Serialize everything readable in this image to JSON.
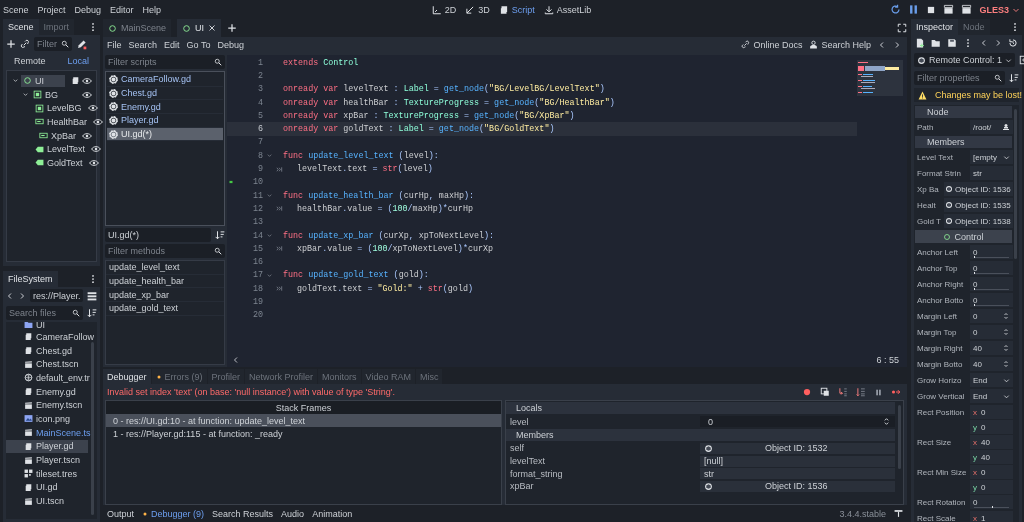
{
  "menu": [
    "Scene",
    "Project",
    "Debug",
    "Editor",
    "Help"
  ],
  "workspaces": [
    {
      "label": "2D",
      "selected": false
    },
    {
      "label": "3D",
      "selected": false
    },
    {
      "label": "Script",
      "selected": true
    },
    {
      "label": "AssetLib",
      "selected": false
    }
  ],
  "renderer": "GLES3",
  "scene_dock": {
    "tabs": [
      {
        "label": "Scene",
        "selected": true
      },
      {
        "label": "Import",
        "selected": false
      }
    ],
    "filter": {
      "placeholder": "Filter"
    },
    "modes": [
      {
        "label": "Remote",
        "selected": false
      },
      {
        "label": "Local",
        "selected": true
      }
    ],
    "tree": [
      {
        "name": "UI",
        "kind": "control",
        "selected": true,
        "script": true,
        "expanded": true,
        "children": [
          {
            "name": "BG",
            "kind": "panel",
            "selected": false,
            "expanded": true,
            "children": [
              {
                "name": "LevelBG",
                "kind": "panel",
                "selected": false
              },
              {
                "name": "HealthBar",
                "kind": "progress",
                "selected": false
              },
              {
                "name": "XpBar",
                "kind": "progress",
                "selected": false
              },
              {
                "name": "LevelText",
                "kind": "label",
                "selected": false
              },
              {
                "name": "GoldText",
                "kind": "label",
                "selected": false
              }
            ]
          }
        ]
      }
    ]
  },
  "filesystem": {
    "tab": "FileSystem",
    "path": "res://Player.",
    "search": {
      "placeholder": "Search files"
    },
    "files": [
      {
        "name": "UI",
        "kind": "folder",
        "selected": false,
        "highlighted": false
      },
      {
        "name": "CameraFollow",
        "kind": "script",
        "selected": false,
        "highlighted": false
      },
      {
        "name": "Chest.gd",
        "kind": "script",
        "selected": false,
        "highlighted": false
      },
      {
        "name": "Chest.tscn",
        "kind": "scene",
        "selected": false,
        "highlighted": false
      },
      {
        "name": "default_env.tr",
        "kind": "environment",
        "selected": false,
        "highlighted": false
      },
      {
        "name": "Enemy.gd",
        "kind": "script",
        "selected": false,
        "highlighted": false
      },
      {
        "name": "Enemy.tscn",
        "kind": "scene",
        "selected": false,
        "highlighted": false
      },
      {
        "name": "icon.png",
        "kind": "image",
        "selected": false,
        "highlighted": false
      },
      {
        "name": "MainScene.ts",
        "kind": "scene",
        "selected": false,
        "highlighted": true
      },
      {
        "name": "Player.gd",
        "kind": "script",
        "selected": true,
        "highlighted": false
      },
      {
        "name": "Player.tscn",
        "kind": "scene",
        "selected": false,
        "highlighted": false
      },
      {
        "name": "tileset.tres",
        "kind": "tileset",
        "selected": false,
        "highlighted": false
      },
      {
        "name": "UI.gd",
        "kind": "script",
        "selected": false,
        "highlighted": false
      },
      {
        "name": "UI.tscn",
        "kind": "scene",
        "selected": false,
        "highlighted": false
      }
    ]
  },
  "scene_tabs": [
    {
      "label": "MainScene",
      "selected": false
    },
    {
      "label": "UI",
      "selected": true
    }
  ],
  "script_menu": [
    "File",
    "Search",
    "Edit",
    "Go To",
    "Debug"
  ],
  "help_links": [
    "Online Docs",
    "Search Help"
  ],
  "scripts": {
    "filter": {
      "placeholder": "Filter scripts"
    },
    "items": [
      {
        "name": "CameraFollow.gd",
        "selected": false
      },
      {
        "name": "Chest.gd",
        "selected": false
      },
      {
        "name": "Enemy.gd",
        "selected": false
      },
      {
        "name": "Player.gd",
        "selected": false
      },
      {
        "name": "UI.gd(*)",
        "selected": true
      }
    ]
  },
  "methods": {
    "title": "UI.gd(*)",
    "filter": {
      "placeholder": "Filter methods"
    },
    "items": [
      "update_level_text",
      "update_health_bar",
      "update_xp_bar",
      "update_gold_text"
    ]
  },
  "code": {
    "cursor": "6 : 55",
    "lines": [
      {
        "number": "1",
        "fold": false,
        "indent": false,
        "current": false,
        "executing": false,
        "tokens": [
          {
            "kind": "kw",
            "text": "extends "
          },
          {
            "kind": "type",
            "text": "Control"
          }
        ]
      },
      {
        "number": "2",
        "fold": false,
        "indent": false,
        "current": false,
        "executing": false
      },
      {
        "number": "3",
        "fold": false,
        "indent": false,
        "current": false,
        "executing": false,
        "tokens": [
          {
            "kind": "kw",
            "text": "onready var "
          },
          {
            "kind": "id",
            "text": "levelText "
          },
          {
            "kind": "sym",
            "text": ": "
          },
          {
            "kind": "type",
            "text": "Label"
          },
          {
            "kind": "sym",
            "text": " = "
          },
          {
            "kind": "fn",
            "text": "get_node"
          },
          {
            "kind": "sym",
            "text": "("
          },
          {
            "kind": "str",
            "text": "\"BG/LevelBG/LevelText\""
          },
          {
            "kind": "sym",
            "text": ")"
          }
        ]
      },
      {
        "number": "4",
        "fold": false,
        "indent": false,
        "current": false,
        "executing": false,
        "tokens": [
          {
            "kind": "kw",
            "text": "onready var "
          },
          {
            "kind": "id",
            "text": "healthBar "
          },
          {
            "kind": "sym",
            "text": ": "
          },
          {
            "kind": "type",
            "text": "TextureProgress"
          },
          {
            "kind": "sym",
            "text": " = "
          },
          {
            "kind": "fn",
            "text": "get_node"
          },
          {
            "kind": "sym",
            "text": "("
          },
          {
            "kind": "str",
            "text": "\"BG/HealthBar\""
          },
          {
            "kind": "sym",
            "text": ")"
          }
        ]
      },
      {
        "number": "5",
        "fold": false,
        "indent": false,
        "current": false,
        "executing": false,
        "tokens": [
          {
            "kind": "kw",
            "text": "onready var "
          },
          {
            "kind": "id",
            "text": "xpBar "
          },
          {
            "kind": "sym",
            "text": ": "
          },
          {
            "kind": "type",
            "text": "TextureProgress"
          },
          {
            "kind": "sym",
            "text": " = "
          },
          {
            "kind": "fn",
            "text": "get_node"
          },
          {
            "kind": "sym",
            "text": "("
          },
          {
            "kind": "str",
            "text": "\"BG/XpBar\""
          },
          {
            "kind": "sym",
            "text": ")"
          }
        ]
      },
      {
        "number": "6",
        "fold": false,
        "indent": false,
        "current": true,
        "executing": false,
        "tokens": [
          {
            "kind": "kw",
            "text": "onready var "
          },
          {
            "kind": "id",
            "text": "goldText "
          },
          {
            "kind": "sym",
            "text": ": "
          },
          {
            "kind": "type",
            "text": "Label"
          },
          {
            "kind": "sym",
            "text": " = "
          },
          {
            "kind": "fn",
            "text": "get_node"
          },
          {
            "kind": "sym",
            "text": "("
          },
          {
            "kind": "str",
            "text": "\"BG/GoldText\""
          },
          {
            "kind": "sym",
            "text": ")"
          }
        ]
      },
      {
        "number": "7",
        "fold": false,
        "indent": false,
        "current": false,
        "executing": false
      },
      {
        "number": "8",
        "fold": true,
        "indent": false,
        "current": false,
        "executing": false,
        "tokens": [
          {
            "kind": "kw",
            "text": "func "
          },
          {
            "kind": "fn",
            "text": "update_level_text"
          },
          {
            "kind": "sym",
            "text": " ("
          },
          {
            "kind": "id",
            "text": "level"
          },
          {
            "kind": "sym",
            "text": "):"
          }
        ]
      },
      {
        "number": "9",
        "fold": false,
        "indent": true,
        "current": false,
        "executing": false,
        "tokens": [
          {
            "kind": "id",
            "text": "levelText"
          },
          {
            "kind": "sym",
            "text": "."
          },
          {
            "kind": "id",
            "text": "text "
          },
          {
            "kind": "sym",
            "text": "= "
          },
          {
            "kind": "kw",
            "text": "str"
          },
          {
            "kind": "sym",
            "text": "("
          },
          {
            "kind": "id",
            "text": "level"
          },
          {
            "kind": "sym",
            "text": ")"
          }
        ]
      },
      {
        "number": "10",
        "fold": false,
        "indent": false,
        "current": false,
        "executing": true
      },
      {
        "number": "11",
        "fold": true,
        "indent": false,
        "current": false,
        "executing": false,
        "tokens": [
          {
            "kind": "kw",
            "text": "func "
          },
          {
            "kind": "fn",
            "text": "update_health_bar"
          },
          {
            "kind": "sym",
            "text": " ("
          },
          {
            "kind": "id",
            "text": "curHp"
          },
          {
            "kind": "sym",
            "text": ", "
          },
          {
            "kind": "id",
            "text": "maxHp"
          },
          {
            "kind": "sym",
            "text": "):"
          }
        ]
      },
      {
        "number": "12",
        "fold": false,
        "indent": true,
        "current": false,
        "executing": false,
        "tokens": [
          {
            "kind": "id",
            "text": "healthBar"
          },
          {
            "kind": "sym",
            "text": "."
          },
          {
            "kind": "id",
            "text": "value "
          },
          {
            "kind": "sym",
            "text": "= ("
          },
          {
            "kind": "num",
            "text": "100"
          },
          {
            "kind": "sym",
            "text": "/"
          },
          {
            "kind": "id",
            "text": "maxHp"
          },
          {
            "kind": "sym",
            "text": ")*"
          },
          {
            "kind": "id",
            "text": "curHp"
          }
        ]
      },
      {
        "number": "13",
        "fold": false,
        "indent": false,
        "current": false,
        "executing": false
      },
      {
        "number": "14",
        "fold": true,
        "indent": false,
        "current": false,
        "executing": false,
        "tokens": [
          {
            "kind": "kw",
            "text": "func "
          },
          {
            "kind": "fn",
            "text": "update_xp_bar"
          },
          {
            "kind": "sym",
            "text": " ("
          },
          {
            "kind": "id",
            "text": "curXp"
          },
          {
            "kind": "sym",
            "text": ", "
          },
          {
            "kind": "id",
            "text": "xpToNextLevel"
          },
          {
            "kind": "sym",
            "text": "):"
          }
        ]
      },
      {
        "number": "15",
        "fold": false,
        "indent": true,
        "current": false,
        "executing": false,
        "tokens": [
          {
            "kind": "id",
            "text": "xpBar"
          },
          {
            "kind": "sym",
            "text": "."
          },
          {
            "kind": "id",
            "text": "value "
          },
          {
            "kind": "sym",
            "text": "= ("
          },
          {
            "kind": "num",
            "text": "100"
          },
          {
            "kind": "sym",
            "text": "/"
          },
          {
            "kind": "id",
            "text": "xpToNextLevel"
          },
          {
            "kind": "sym",
            "text": ")*"
          },
          {
            "kind": "id",
            "text": "curXp"
          }
        ]
      },
      {
        "number": "16",
        "fold": false,
        "indent": false,
        "current": false,
        "executing": false
      },
      {
        "number": "17",
        "fold": true,
        "indent": false,
        "current": false,
        "executing": false,
        "tokens": [
          {
            "kind": "kw",
            "text": "func "
          },
          {
            "kind": "fn",
            "text": "update_gold_text"
          },
          {
            "kind": "sym",
            "text": " ("
          },
          {
            "kind": "id",
            "text": "gold"
          },
          {
            "kind": "sym",
            "text": "):"
          }
        ]
      },
      {
        "number": "18",
        "fold": false,
        "indent": true,
        "current": false,
        "executing": false,
        "tokens": [
          {
            "kind": "id",
            "text": "goldText"
          },
          {
            "kind": "sym",
            "text": "."
          },
          {
            "kind": "id",
            "text": "text "
          },
          {
            "kind": "sym",
            "text": "= "
          },
          {
            "kind": "str",
            "text": "\"Gold:\""
          },
          {
            "kind": "sym",
            "text": " + "
          },
          {
            "kind": "kw",
            "text": "str"
          },
          {
            "kind": "sym",
            "text": "("
          },
          {
            "kind": "id",
            "text": "gold"
          },
          {
            "kind": "sym",
            "text": ")"
          }
        ]
      },
      {
        "number": "19",
        "fold": false,
        "indent": false,
        "current": false,
        "executing": false
      },
      {
        "number": "20",
        "fold": false,
        "indent": false,
        "current": false,
        "executing": false
      }
    ]
  },
  "debugger": {
    "tabs": [
      {
        "label": "Debugger",
        "selected": true,
        "dot": false
      },
      {
        "label": "Errors (9)",
        "selected": false,
        "dot": true
      },
      {
        "label": "Profiler",
        "selected": false,
        "dot": false
      },
      {
        "label": "Network Profiler",
        "selected": false,
        "dot": false
      },
      {
        "label": "Monitors",
        "selected": false,
        "dot": false
      },
      {
        "label": "Video RAM",
        "selected": false,
        "dot": false
      },
      {
        "label": "Misc",
        "selected": false,
        "dot": false
      }
    ],
    "error": "Invalid set index 'text' (on base: 'null instance') with value of type 'String'.",
    "stack_title": "Stack Frames",
    "frames": [
      {
        "text": "0 - res://UI.gd:10 - at function: update_level_text",
        "selected": true
      },
      {
        "text": "1 - res://Player.gd:115 - at function: _ready",
        "selected": false
      }
    ],
    "variables": [
      {
        "kind": "section",
        "label": "Locals"
      },
      {
        "kind": "spin",
        "label": "level",
        "value": "0"
      },
      {
        "kind": "section",
        "label": "Members"
      },
      {
        "kind": "object",
        "label": "self",
        "value": "Object ID: 1532"
      },
      {
        "kind": "text",
        "label": "levelText",
        "value": "[null]"
      },
      {
        "kind": "text",
        "label": "format_string",
        "value": "str"
      },
      {
        "kind": "object",
        "label": "xpBar",
        "value": "Object ID: 1536"
      }
    ]
  },
  "bottom_bar": {
    "tabs": [
      {
        "label": "Output",
        "selected": false,
        "dot": false
      },
      {
        "label": "Debugger (9)",
        "selected": true,
        "dot": true
      },
      {
        "label": "Search Results",
        "selected": false,
        "dot": false
      },
      {
        "label": "Audio",
        "selected": false,
        "dot": false
      },
      {
        "label": "Animation",
        "selected": false,
        "dot": false
      }
    ],
    "version": "3.4.4.stable"
  },
  "inspector": {
    "tabs": [
      {
        "label": "Inspector",
        "selected": true
      },
      {
        "label": "Node",
        "selected": false
      }
    ],
    "object": "Remote Control: 1",
    "filter": {
      "placeholder": "Filter properties"
    },
    "warning": "Changes may be lost!",
    "properties": [
      {
        "kind": "section",
        "label": "Node"
      },
      {
        "kind": "path",
        "label": "Path",
        "value": "/root/"
      },
      {
        "kind": "section",
        "label": "Members"
      },
      {
        "kind": "dropdown",
        "label": "Level Text",
        "value": "[empty"
      },
      {
        "kind": "text",
        "label": "Format Strin",
        "value": "str"
      },
      {
        "kind": "object",
        "label": "Xp Ba",
        "value": "Object ID: 1536"
      },
      {
        "kind": "object",
        "label": "Healt",
        "value": "Object ID: 1535"
      },
      {
        "kind": "object",
        "label": "Gold T",
        "value": "Object ID: 1538"
      },
      {
        "kind": "category",
        "label": "Control"
      },
      {
        "kind": "slider",
        "label": "Anchor Left",
        "value": "0",
        "level": 0
      },
      {
        "kind": "slider",
        "label": "Anchor Top",
        "value": "0",
        "level": 0
      },
      {
        "kind": "slider",
        "label": "Anchor Right",
        "value": "0",
        "level": 0
      },
      {
        "kind": "slider",
        "label": "Anchor Botto",
        "value": "0",
        "level": 0
      },
      {
        "kind": "spin",
        "label": "Margin Left",
        "value": "0"
      },
      {
        "kind": "spin",
        "label": "Margin Top",
        "value": "0"
      },
      {
        "kind": "spin",
        "label": "Margin Right",
        "value": "40"
      },
      {
        "kind": "spin",
        "label": "Margin Botto",
        "value": "40"
      },
      {
        "kind": "dropdown",
        "label": "Grow Horizo",
        "value": "End"
      },
      {
        "kind": "dropdown",
        "label": "Grow Vertical",
        "value": "End"
      },
      {
        "kind": "vector",
        "label": "Rect Position",
        "components": [
          {
            "axis": "x",
            "value": "0"
          },
          {
            "axis": "y",
            "value": "0"
          }
        ]
      },
      {
        "kind": "vector",
        "label": "Rect Size",
        "components": [
          {
            "axis": "x",
            "value": "40"
          },
          {
            "axis": "y",
            "value": "40"
          }
        ]
      },
      {
        "kind": "vector",
        "label": "Rect Min Size",
        "components": [
          {
            "axis": "x",
            "value": "0"
          },
          {
            "axis": "y",
            "value": "0"
          }
        ]
      },
      {
        "kind": "slider",
        "label": "Rect Rotation",
        "value": "0",
        "level": 0.5
      },
      {
        "kind": "vector",
        "label": "Rect Scale",
        "components": [
          {
            "axis": "x",
            "value": "1"
          }
        ]
      }
    ]
  }
}
